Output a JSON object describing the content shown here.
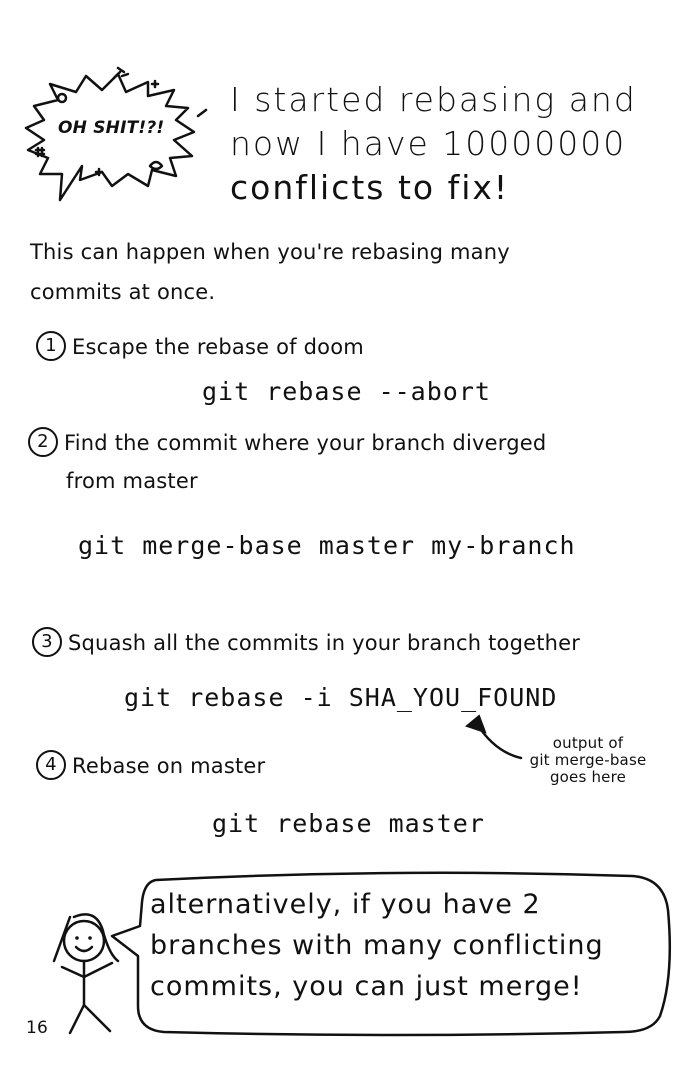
{
  "header": {
    "burst_text": "OH SHIT!?!",
    "title_lines": [
      "I started rebasing and",
      "now I have 10000000",
      "conflicts to fix!"
    ]
  },
  "intro_lines": [
    "This can happen when you're rebasing many",
    "commits at once."
  ],
  "steps": [
    {
      "number": "1",
      "lines": [
        "Escape the rebase of doom"
      ],
      "command": "git rebase --abort"
    },
    {
      "number": "2",
      "lines": [
        "Find the commit where your branch diverged",
        "from master"
      ],
      "command": "git merge-base master my-branch"
    },
    {
      "number": "3",
      "lines": [
        "Squash all the commits in your branch together"
      ],
      "command": "git rebase -i SHA_YOU_FOUND"
    },
    {
      "number": "4",
      "lines": [
        "Rebase on master"
      ],
      "command": "git rebase master"
    }
  ],
  "annotation_lines": [
    "output of",
    "git merge-base",
    "goes here"
  ],
  "speech_bubble_lines": [
    "alternatively, if you have 2",
    "branches with many conflicting",
    "commits, you can just merge!"
  ],
  "page_number": "16"
}
